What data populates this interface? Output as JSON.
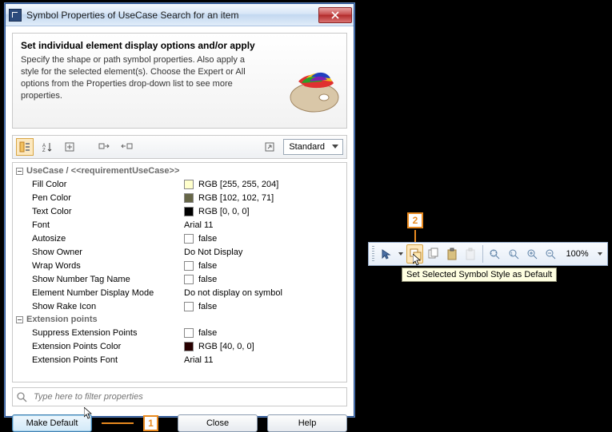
{
  "dialog": {
    "title": "Symbol Properties of UseCase Search for an item",
    "info_title": "Set individual element display options and/or apply",
    "info_text": "Specify the shape or path symbol properties. Also apply a style for the selected element(s). Choose the Expert or All options from the Properties drop-down list to see more properties.",
    "view_mode": "Standard"
  },
  "groups": [
    {
      "header": "UseCase / <<requirementUseCase>>",
      "rows": [
        {
          "label": "Fill Color",
          "type": "color",
          "swatch": "#FFFFCC",
          "value": "RGB [255, 255, 204]"
        },
        {
          "label": "Pen Color",
          "type": "color",
          "swatch": "#666647",
          "value": "RGB [102, 102, 71]"
        },
        {
          "label": "Text Color",
          "type": "color",
          "swatch": "#000000",
          "value": "RGB [0, 0, 0]"
        },
        {
          "label": "Font",
          "type": "text",
          "value": "Arial 11"
        },
        {
          "label": "Autosize",
          "type": "bool",
          "value": "false"
        },
        {
          "label": "Show Owner",
          "type": "text",
          "value": "Do Not Display"
        },
        {
          "label": "Wrap Words",
          "type": "bool",
          "value": "false"
        },
        {
          "label": "Show Number Tag Name",
          "type": "bool",
          "value": "false"
        },
        {
          "label": "Element Number Display Mode",
          "type": "text",
          "value": "Do not display on symbol"
        },
        {
          "label": "Show Rake Icon",
          "type": "bool",
          "value": "false"
        }
      ]
    },
    {
      "header": "Extension points",
      "rows": [
        {
          "label": "Suppress Extension Points",
          "type": "bool",
          "value": "false"
        },
        {
          "label": "Extension Points Color",
          "type": "color",
          "swatch": "#280000",
          "value": "RGB [40, 0, 0]"
        },
        {
          "label": "Extension Points Font",
          "type": "text",
          "value": "Arial 11"
        }
      ]
    }
  ],
  "filter": {
    "placeholder": "Type here to filter properties"
  },
  "buttons": {
    "make_default": "Make Default",
    "close": "Close",
    "help": "Help"
  },
  "callouts": {
    "one": "1",
    "two": "2"
  },
  "float": {
    "zoom": "100%",
    "tooltip": "Set Selected Symbol Style as Default"
  }
}
